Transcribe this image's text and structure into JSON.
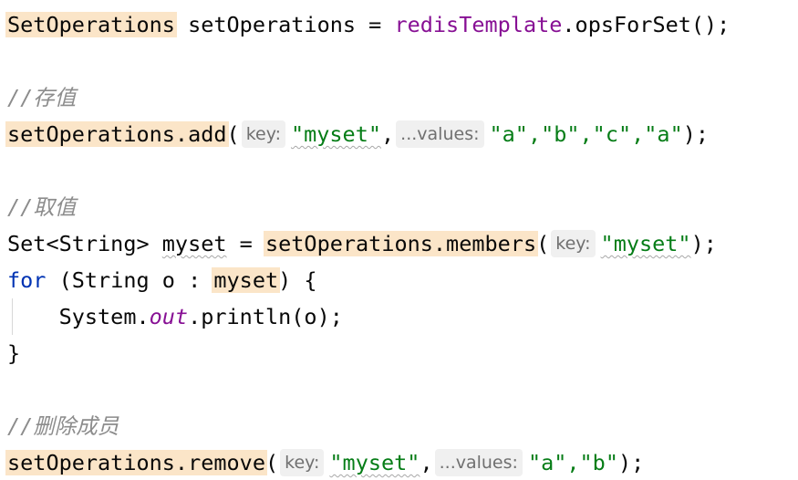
{
  "code": {
    "l1": {
      "type": "SetOperations",
      "decl": " setOperations = ",
      "field": "redisTemplate",
      "call": ".opsForSet();"
    },
    "l2": {
      "comment": "//存值"
    },
    "l3": {
      "receiver": "setOperations.add",
      "open": "(",
      "hint_key": "key:",
      "key_value": "\"myset\"",
      "sep": ",",
      "hint_values": "...values:",
      "values": "\"a\",\"b\",\"c\",\"a\"",
      "close": ");"
    },
    "l4": {
      "comment": "//取值"
    },
    "l5": {
      "decl": "Set<String> ",
      "var": "myset",
      "eq": " = ",
      "receiver": "setOperations.members",
      "open": "(",
      "hint_key": "key:",
      "key_value": "\"myset\"",
      "close": ");"
    },
    "l6": {
      "kw": "for",
      "head": " (String o : ",
      "var": "myset",
      "tail": ") {"
    },
    "l7": {
      "indent": "    ",
      "sys": "System.",
      "out": "out",
      "call": ".println(o);"
    },
    "l8": {
      "brace": "}"
    },
    "l9": {
      "comment": "//删除成员"
    },
    "l10": {
      "receiver": "setOperations.remove",
      "open": "(",
      "hint_key": "key:",
      "key_value": "\"myset\"",
      "sep": ",",
      "hint_values": "...values:",
      "values": "\"a\",\"b\"",
      "close": ");"
    }
  },
  "colors": {
    "background": "#ffffff",
    "highlight": "#fbe5c8",
    "comment": "#8c8c8c",
    "string": "#067d17",
    "keyword": "#0033b3",
    "field": "#871094",
    "hint_background": "#f0f0f0"
  }
}
